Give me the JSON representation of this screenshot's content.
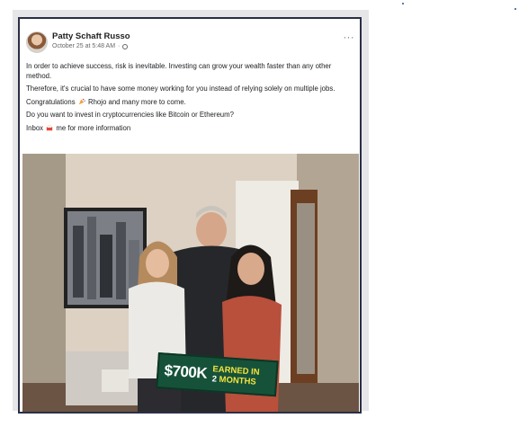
{
  "post": {
    "author": "Patty Schaft Russo",
    "timestamp": "October 25 at 5:48 AM",
    "separator": "·",
    "more_label": "···",
    "paragraphs": {
      "p1": "In order to achieve success, risk is inevitable. Investing can grow your wealth faster than any other method.",
      "p2": "Therefore, it's crucial to have some money working for you instead of relying solely on multiple jobs.",
      "p3_before": "Congratulations",
      "p3_after": "Rhojo and many more to come.",
      "p4": "Do you want to invest in cryptocurrencies like Bitcoin or Ethereum?",
      "p5_before": "Inbox",
      "p5_after": "me for more information"
    },
    "banner": {
      "amount": "$700K",
      "line1": "EARNED IN",
      "line2_num": "2",
      "line2_word": "MONTHS"
    }
  },
  "icons": [
    "avatar",
    "globe-icon",
    "more-icon",
    "party-icon",
    "inbox-icon"
  ],
  "colors": {
    "frame_border": "#2a2f45",
    "banner_green": "#16523a",
    "banner_yellow": "#f4e33c"
  }
}
